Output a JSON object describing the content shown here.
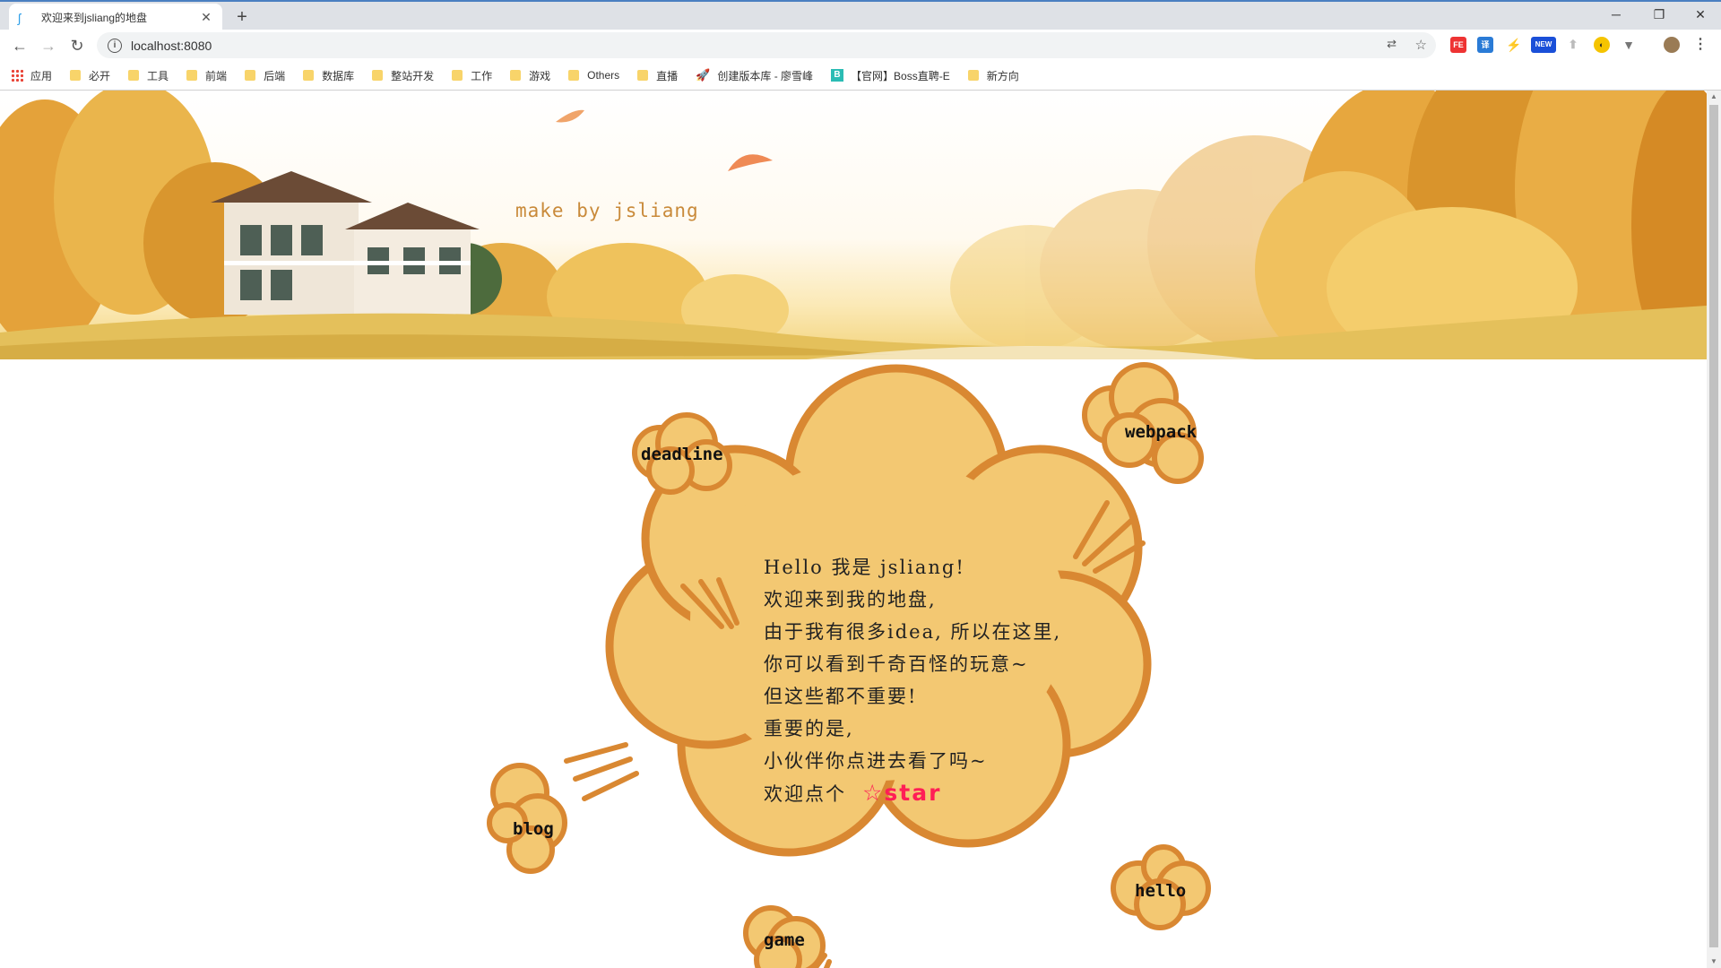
{
  "browser": {
    "tab_title": "欢迎来到jsliang的地盘",
    "url": "localhost:8080",
    "window_controls": [
      "minimize-icon",
      "restore-icon",
      "close-icon"
    ],
    "bookmarks": [
      {
        "label": "应用",
        "icon": "apps-icon"
      },
      {
        "label": "必开",
        "icon": "folder-icon"
      },
      {
        "label": "工具",
        "icon": "folder-icon"
      },
      {
        "label": "前端",
        "icon": "folder-icon"
      },
      {
        "label": "后端",
        "icon": "folder-icon"
      },
      {
        "label": "数据库",
        "icon": "folder-icon"
      },
      {
        "label": "整站开发",
        "icon": "folder-icon"
      },
      {
        "label": "工作",
        "icon": "folder-icon"
      },
      {
        "label": "游戏",
        "icon": "folder-icon"
      },
      {
        "label": "Others",
        "icon": "folder-icon"
      },
      {
        "label": "直播",
        "icon": "folder-icon"
      },
      {
        "label": "创建版本库 - 廖雪峰",
        "icon": "rocket-icon"
      },
      {
        "label": "【官网】Boss直聘-E",
        "icon": "boss-icon"
      },
      {
        "label": "新方向",
        "icon": "folder-icon"
      }
    ],
    "extensions": {
      "new_badge": "NEW",
      "fe_badge": "FE",
      "translate_badge": "译"
    }
  },
  "banner": {
    "credit": "make by jsliang"
  },
  "bubble": {
    "lines": [
      "Hello 我是 jsliang!",
      "欢迎来到我的地盘,",
      "由于我有很多idea, 所以在这里,",
      "你可以看到千奇百怪的玩意~",
      "但这些都不重要!",
      "重要的是,",
      "小伙伴你点进去看了吗~"
    ],
    "last_line_prefix": "欢迎点个",
    "star_label": "☆star"
  },
  "nav_clouds": {
    "deadline": "deadline",
    "webpack": "webpack",
    "blog": "blog",
    "hello": "hello",
    "game": "game"
  },
  "colors": {
    "cloud_fill": "#f3c872",
    "cloud_stroke": "#d98832",
    "star": "#ff1e56",
    "credit": "#c98a3a"
  }
}
